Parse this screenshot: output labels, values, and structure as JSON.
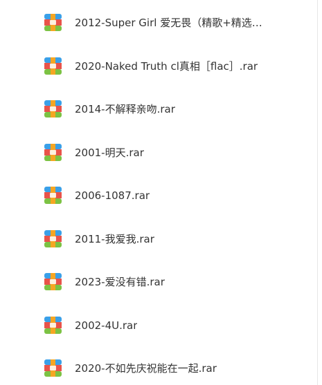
{
  "files": [
    {
      "name": "2012-Super Girl 爱无畏（精歌+精选…",
      "icon": "rar-archive-icon"
    },
    {
      "name": "2020-Naked Truth cl真相［flac］.rar",
      "icon": "rar-archive-icon"
    },
    {
      "name": "2014-不解释亲吻.rar",
      "icon": "rar-archive-icon"
    },
    {
      "name": "2001-明天.rar",
      "icon": "rar-archive-icon"
    },
    {
      "name": "2006-1087.rar",
      "icon": "rar-archive-icon"
    },
    {
      "name": "2011-我爱我.rar",
      "icon": "rar-archive-icon"
    },
    {
      "name": "2023-爱没有错.rar",
      "icon": "rar-archive-icon"
    },
    {
      "name": "2002-4U.rar",
      "icon": "rar-archive-icon"
    },
    {
      "name": "2020-不如先庆祝能在一起.rar",
      "icon": "rar-archive-icon"
    }
  ],
  "colors": {
    "icon_blue": "#3aa0e8",
    "icon_orange": "#f5a623",
    "icon_red": "#e8534a",
    "icon_green": "#7cc243"
  }
}
